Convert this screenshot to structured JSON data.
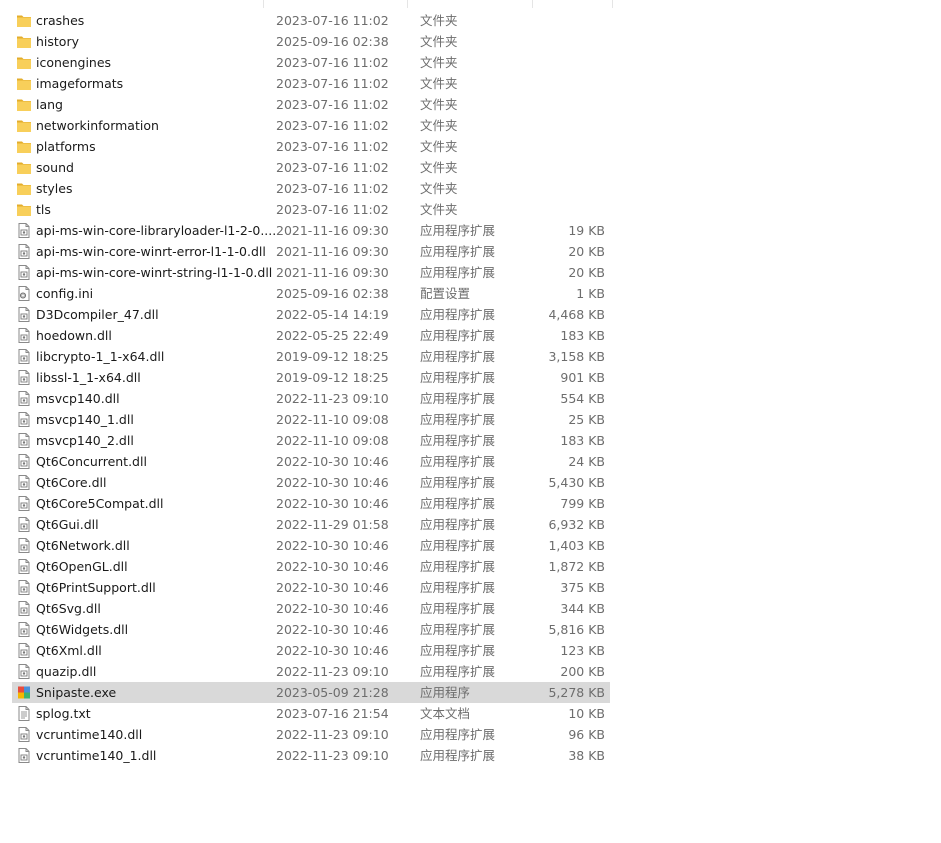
{
  "files": [
    {
      "name": "crashes",
      "date": "2023-07-16 11:02",
      "type": "文件夹",
      "size": "",
      "icon": "folder-icon",
      "selected": false
    },
    {
      "name": "history",
      "date": "2025-09-16 02:38",
      "type": "文件夹",
      "size": "",
      "icon": "folder-icon",
      "selected": false
    },
    {
      "name": "iconengines",
      "date": "2023-07-16 11:02",
      "type": "文件夹",
      "size": "",
      "icon": "folder-icon",
      "selected": false
    },
    {
      "name": "imageformats",
      "date": "2023-07-16 11:02",
      "type": "文件夹",
      "size": "",
      "icon": "folder-icon",
      "selected": false
    },
    {
      "name": "lang",
      "date": "2023-07-16 11:02",
      "type": "文件夹",
      "size": "",
      "icon": "folder-icon",
      "selected": false
    },
    {
      "name": "networkinformation",
      "date": "2023-07-16 11:02",
      "type": "文件夹",
      "size": "",
      "icon": "folder-icon",
      "selected": false
    },
    {
      "name": "platforms",
      "date": "2023-07-16 11:02",
      "type": "文件夹",
      "size": "",
      "icon": "folder-icon",
      "selected": false
    },
    {
      "name": "sound",
      "date": "2023-07-16 11:02",
      "type": "文件夹",
      "size": "",
      "icon": "folder-icon",
      "selected": false
    },
    {
      "name": "styles",
      "date": "2023-07-16 11:02",
      "type": "文件夹",
      "size": "",
      "icon": "folder-icon",
      "selected": false
    },
    {
      "name": "tls",
      "date": "2023-07-16 11:02",
      "type": "文件夹",
      "size": "",
      "icon": "folder-icon",
      "selected": false
    },
    {
      "name": "api-ms-win-core-libraryloader-l1-2-0....",
      "date": "2021-11-16 09:30",
      "type": "应用程序扩展",
      "size": "19 KB",
      "icon": "dll-file-icon",
      "selected": false
    },
    {
      "name": "api-ms-win-core-winrt-error-l1-1-0.dll",
      "date": "2021-11-16 09:30",
      "type": "应用程序扩展",
      "size": "20 KB",
      "icon": "dll-file-icon",
      "selected": false
    },
    {
      "name": "api-ms-win-core-winrt-string-l1-1-0.dll",
      "date": "2021-11-16 09:30",
      "type": "应用程序扩展",
      "size": "20 KB",
      "icon": "dll-file-icon",
      "selected": false
    },
    {
      "name": "config.ini",
      "date": "2025-09-16 02:38",
      "type": "配置设置",
      "size": "1 KB",
      "icon": "ini-file-icon",
      "selected": false
    },
    {
      "name": "D3Dcompiler_47.dll",
      "date": "2022-05-14 14:19",
      "type": "应用程序扩展",
      "size": "4,468 KB",
      "icon": "dll-file-icon",
      "selected": false
    },
    {
      "name": "hoedown.dll",
      "date": "2022-05-25 22:49",
      "type": "应用程序扩展",
      "size": "183 KB",
      "icon": "dll-file-icon",
      "selected": false
    },
    {
      "name": "libcrypto-1_1-x64.dll",
      "date": "2019-09-12 18:25",
      "type": "应用程序扩展",
      "size": "3,158 KB",
      "icon": "dll-file-icon",
      "selected": false
    },
    {
      "name": "libssl-1_1-x64.dll",
      "date": "2019-09-12 18:25",
      "type": "应用程序扩展",
      "size": "901 KB",
      "icon": "dll-file-icon",
      "selected": false
    },
    {
      "name": "msvcp140.dll",
      "date": "2022-11-23 09:10",
      "type": "应用程序扩展",
      "size": "554 KB",
      "icon": "dll-file-icon",
      "selected": false
    },
    {
      "name": "msvcp140_1.dll",
      "date": "2022-11-10 09:08",
      "type": "应用程序扩展",
      "size": "25 KB",
      "icon": "dll-file-icon",
      "selected": false
    },
    {
      "name": "msvcp140_2.dll",
      "date": "2022-11-10 09:08",
      "type": "应用程序扩展",
      "size": "183 KB",
      "icon": "dll-file-icon",
      "selected": false
    },
    {
      "name": "Qt6Concurrent.dll",
      "date": "2022-10-30 10:46",
      "type": "应用程序扩展",
      "size": "24 KB",
      "icon": "dll-file-icon",
      "selected": false
    },
    {
      "name": "Qt6Core.dll",
      "date": "2022-10-30 10:46",
      "type": "应用程序扩展",
      "size": "5,430 KB",
      "icon": "dll-file-icon",
      "selected": false
    },
    {
      "name": "Qt6Core5Compat.dll",
      "date": "2022-10-30 10:46",
      "type": "应用程序扩展",
      "size": "799 KB",
      "icon": "dll-file-icon",
      "selected": false
    },
    {
      "name": "Qt6Gui.dll",
      "date": "2022-11-29 01:58",
      "type": "应用程序扩展",
      "size": "6,932 KB",
      "icon": "dll-file-icon",
      "selected": false
    },
    {
      "name": "Qt6Network.dll",
      "date": "2022-10-30 10:46",
      "type": "应用程序扩展",
      "size": "1,403 KB",
      "icon": "dll-file-icon",
      "selected": false
    },
    {
      "name": "Qt6OpenGL.dll",
      "date": "2022-10-30 10:46",
      "type": "应用程序扩展",
      "size": "1,872 KB",
      "icon": "dll-file-icon",
      "selected": false
    },
    {
      "name": "Qt6PrintSupport.dll",
      "date": "2022-10-30 10:46",
      "type": "应用程序扩展",
      "size": "375 KB",
      "icon": "dll-file-icon",
      "selected": false
    },
    {
      "name": "Qt6Svg.dll",
      "date": "2022-10-30 10:46",
      "type": "应用程序扩展",
      "size": "344 KB",
      "icon": "dll-file-icon",
      "selected": false
    },
    {
      "name": "Qt6Widgets.dll",
      "date": "2022-10-30 10:46",
      "type": "应用程序扩展",
      "size": "5,816 KB",
      "icon": "dll-file-icon",
      "selected": false
    },
    {
      "name": "Qt6Xml.dll",
      "date": "2022-10-30 10:46",
      "type": "应用程序扩展",
      "size": "123 KB",
      "icon": "dll-file-icon",
      "selected": false
    },
    {
      "name": "quazip.dll",
      "date": "2022-11-23 09:10",
      "type": "应用程序扩展",
      "size": "200 KB",
      "icon": "dll-file-icon",
      "selected": false
    },
    {
      "name": "Snipaste.exe",
      "date": "2023-05-09 21:28",
      "type": "应用程序",
      "size": "5,278 KB",
      "icon": "snipaste-app-icon",
      "selected": true
    },
    {
      "name": "splog.txt",
      "date": "2023-07-16 21:54",
      "type": "文本文档",
      "size": "10 KB",
      "icon": "txt-file-icon",
      "selected": false
    },
    {
      "name": "vcruntime140.dll",
      "date": "2022-11-23 09:10",
      "type": "应用程序扩展",
      "size": "96 KB",
      "icon": "dll-file-icon",
      "selected": false
    },
    {
      "name": "vcruntime140_1.dll",
      "date": "2022-11-23 09:10",
      "type": "应用程序扩展",
      "size": "38 KB",
      "icon": "dll-file-icon",
      "selected": false
    }
  ],
  "colors": {
    "folder": "#f8cf5a",
    "folder_dark": "#e3ad2c",
    "selected_row": "#d9d9d9",
    "meta_text": "#6d6d6d"
  }
}
